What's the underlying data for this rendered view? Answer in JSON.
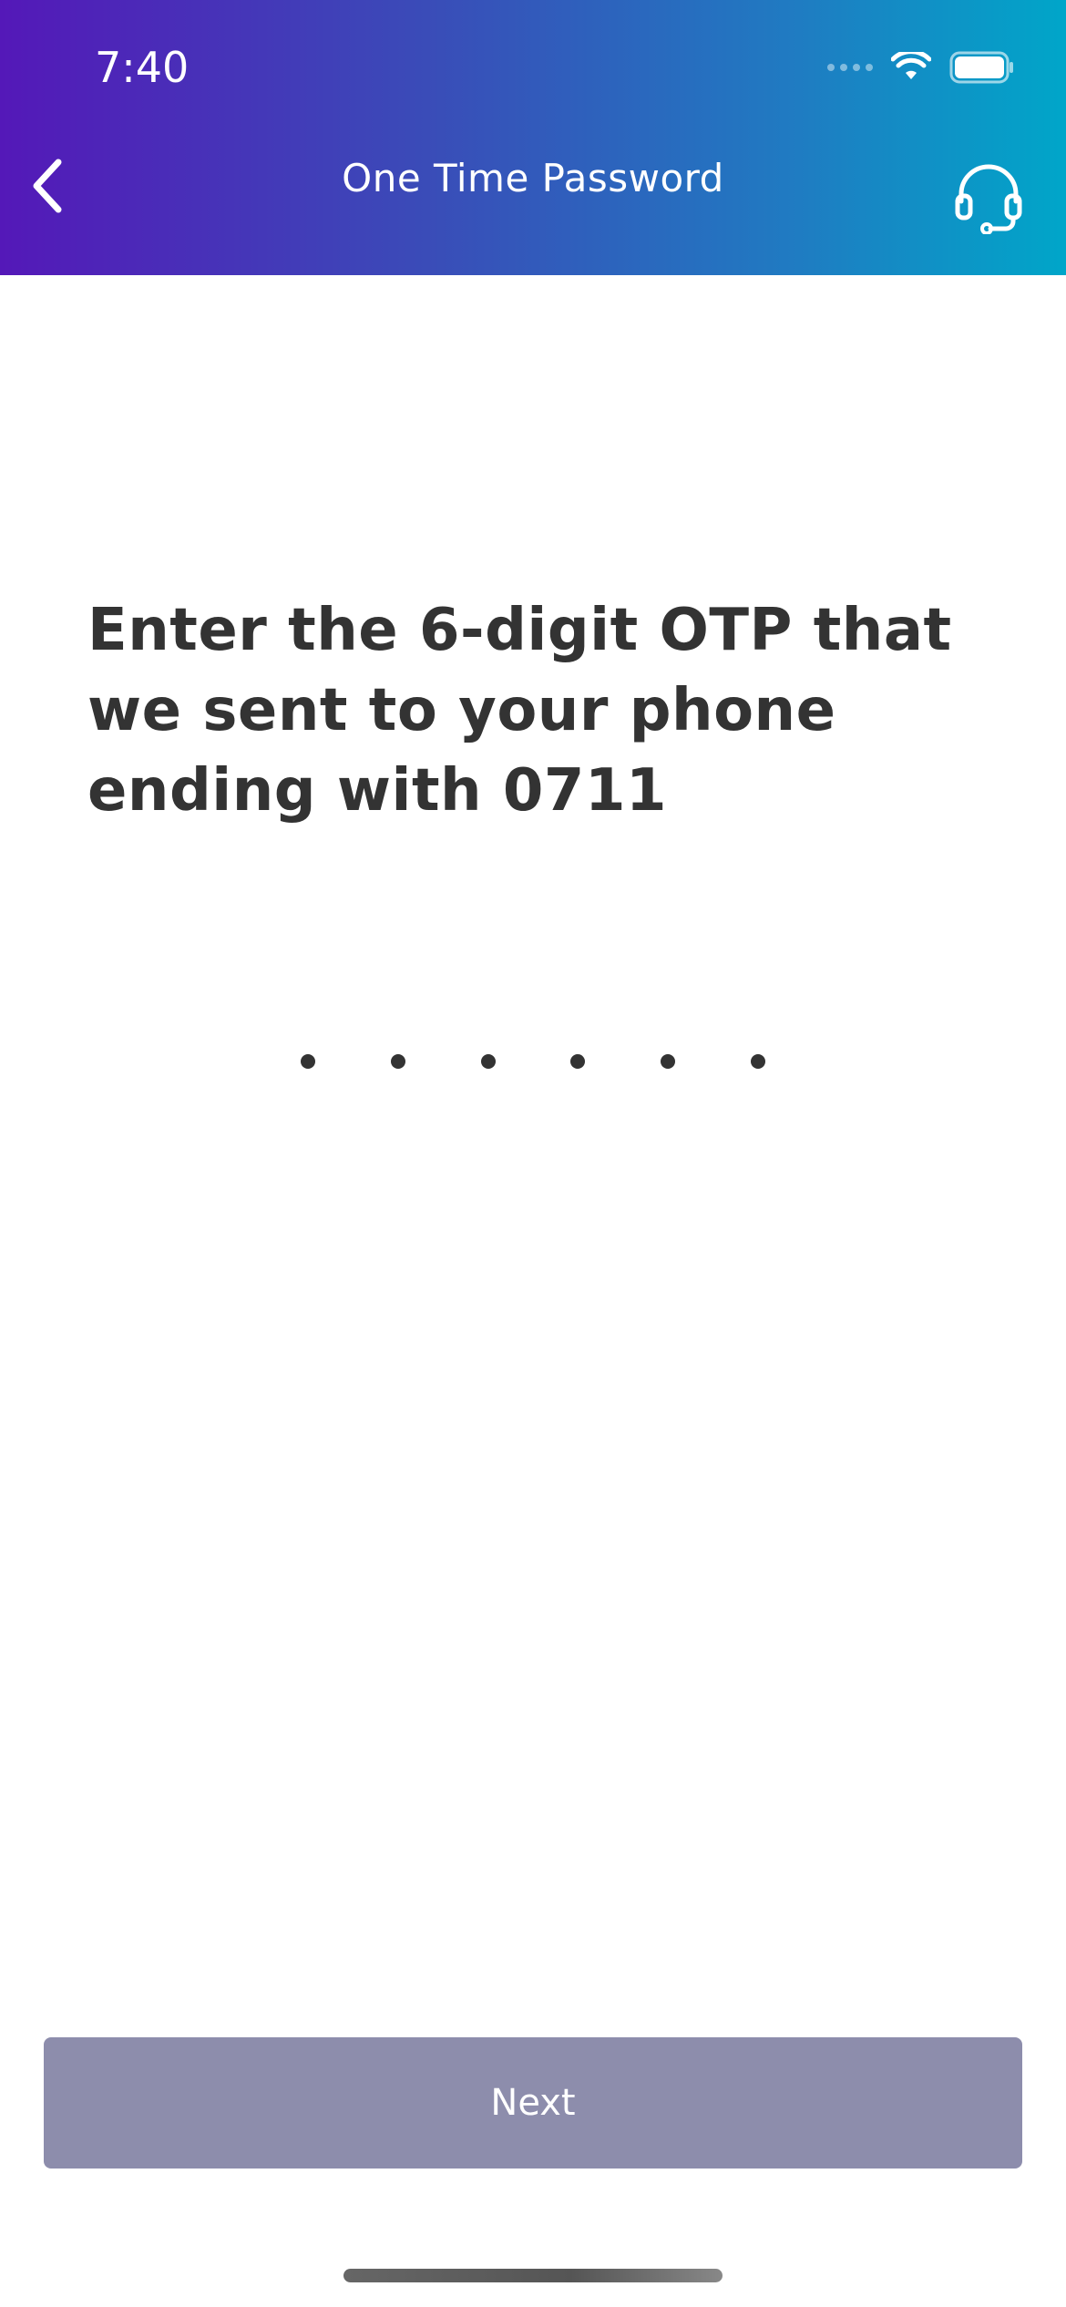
{
  "status_bar": {
    "time": "7:40"
  },
  "nav": {
    "title": "One Time Password",
    "back_icon": "chevron-left-icon",
    "support_icon": "headset-icon"
  },
  "content": {
    "prompt": "Enter the 6-digit OTP that we sent to your phone ending with 0711",
    "otp_placeholder_digits": 6
  },
  "actions": {
    "next_label": "Next"
  },
  "colors": {
    "gradient_start": "#5418b8",
    "gradient_end": "#00a6c9",
    "text_primary": "#333333",
    "button_disabled": "#8d8dac"
  }
}
